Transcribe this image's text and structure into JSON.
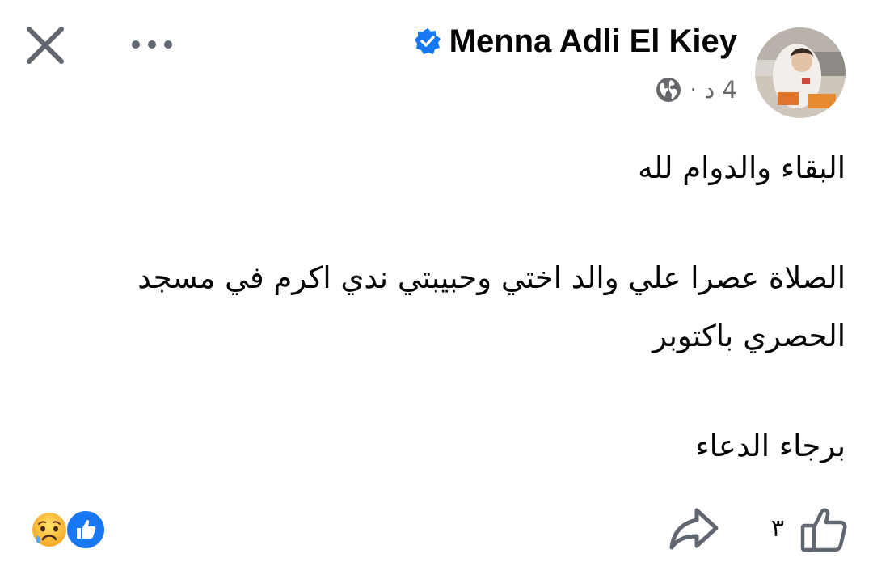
{
  "header": {
    "close_icon": "close-icon",
    "more_icon": "more-horizontal-icon"
  },
  "author": {
    "name": "Menna Adli El Kiey",
    "verified_icon": "verified-badge-icon",
    "time": "4 د",
    "separator": "·",
    "audience_icon": "globe-icon"
  },
  "post": {
    "lines": [
      "البقاء والدوام لله",
      "الصلاة عصرا علي والد اختي وحبيبتي ندي اكرم في مسجد",
      "الحصري باكتوبر",
      "برجاء الدعاء"
    ]
  },
  "footer": {
    "reactions": [
      "sad-emoji-icon",
      "like-reaction-icon"
    ],
    "share_icon": "share-arrow-icon",
    "like_icon": "thumbs-up-icon",
    "like_count": "٣"
  },
  "colors": {
    "primary": "#1877f2",
    "text": "#050505",
    "secondary_text": "#65676b",
    "icon_gray": "#65676b"
  }
}
